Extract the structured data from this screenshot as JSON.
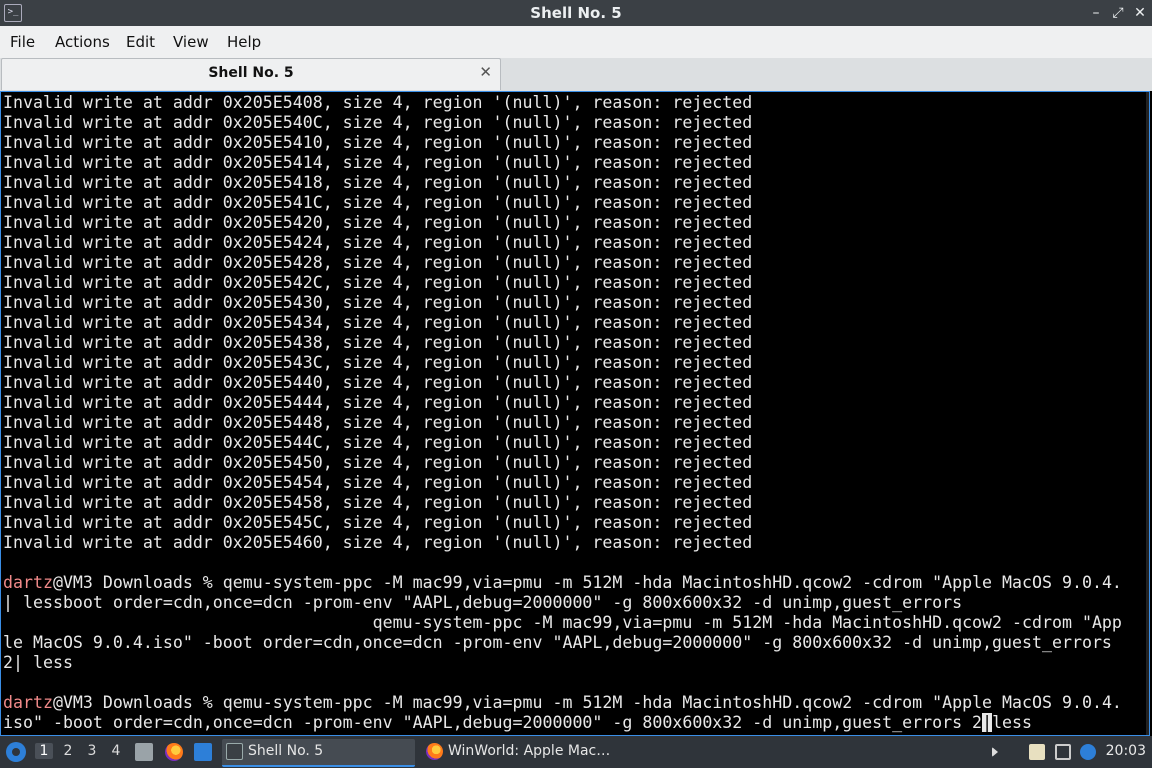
{
  "window": {
    "title": "Shell No. 5",
    "minimize": "–",
    "maximize": "⤢",
    "close": "✕"
  },
  "menu": [
    "File",
    "Actions",
    "Edit",
    "View",
    "Help"
  ],
  "tab": {
    "label": "Shell No. 5",
    "close": "✕"
  },
  "terminal": {
    "error_lines": [
      "Invalid write at addr 0x205E5408, size 4, region '(null)', reason: rejected",
      "Invalid write at addr 0x205E540C, size 4, region '(null)', reason: rejected",
      "Invalid write at addr 0x205E5410, size 4, region '(null)', reason: rejected",
      "Invalid write at addr 0x205E5414, size 4, region '(null)', reason: rejected",
      "Invalid write at addr 0x205E5418, size 4, region '(null)', reason: rejected",
      "Invalid write at addr 0x205E541C, size 4, region '(null)', reason: rejected",
      "Invalid write at addr 0x205E5420, size 4, region '(null)', reason: rejected",
      "Invalid write at addr 0x205E5424, size 4, region '(null)', reason: rejected",
      "Invalid write at addr 0x205E5428, size 4, region '(null)', reason: rejected",
      "Invalid write at addr 0x205E542C, size 4, region '(null)', reason: rejected",
      "Invalid write at addr 0x205E5430, size 4, region '(null)', reason: rejected",
      "Invalid write at addr 0x205E5434, size 4, region '(null)', reason: rejected",
      "Invalid write at addr 0x205E5438, size 4, region '(null)', reason: rejected",
      "Invalid write at addr 0x205E543C, size 4, region '(null)', reason: rejected",
      "Invalid write at addr 0x205E5440, size 4, region '(null)', reason: rejected",
      "Invalid write at addr 0x205E5444, size 4, region '(null)', reason: rejected",
      "Invalid write at addr 0x205E5448, size 4, region '(null)', reason: rejected",
      "Invalid write at addr 0x205E544C, size 4, region '(null)', reason: rejected",
      "Invalid write at addr 0x205E5450, size 4, region '(null)', reason: rejected",
      "Invalid write at addr 0x205E5454, size 4, region '(null)', reason: rejected",
      "Invalid write at addr 0x205E5458, size 4, region '(null)', reason: rejected",
      "Invalid write at addr 0x205E545C, size 4, region '(null)', reason: rejected",
      "Invalid write at addr 0x205E5460, size 4, region '(null)', reason: rejected"
    ],
    "prompt_user": "dartz",
    "prompt_rest": "@VM3 Downloads % ",
    "command1_lines": [
      "qemu-system-ppc -M mac99,via=pmu -m 512M -hda MacintoshHD.qcow2 -cdrom \"Apple MacOS 9.0.4.",
      "| lessboot order=cdn,once=dcn -prom-env \"AAPL,debug=2000000\" -g 800x600x32 -d unimp,guest_errors",
      "                                     qemu-system-ppc -M mac99,via=pmu -m 512M -hda MacintoshHD.qcow2 -cdrom \"App",
      "le MacOS 9.0.4.iso\" -boot order=cdn,once=dcn -prom-env \"AAPL,debug=2000000\" -g 800x600x32 -d unimp,guest_errors",
      "2| less"
    ],
    "command2_first": "qemu-system-ppc -M mac99,via=pmu -m 512M -hda MacintoshHD.qcow2 -cdrom \"Apple MacOS 9.0.4.",
    "command2_second_before": "iso\" -boot order=cdn,once=dcn -prom-env \"AAPL,debug=2000000\" -g 800x600x32 -d unimp,guest_errors 2",
    "cursor_char": "|",
    "command2_second_after": "less"
  },
  "taskbar": {
    "workspaces": [
      "1",
      "2",
      "3",
      "4"
    ],
    "tasks": [
      {
        "label": "Shell No. 5",
        "icon": "terminal-icon"
      },
      {
        "label": "WinWorld: Apple Mac…",
        "icon": "firefox-icon"
      }
    ],
    "clock": "20:03"
  }
}
